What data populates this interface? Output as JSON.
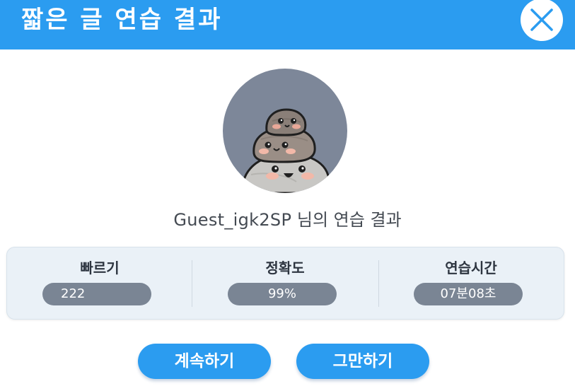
{
  "dialog": {
    "title": "짧은 글 연습 결과",
    "close_icon": "close-icon"
  },
  "user": {
    "name": "Guest_igk2SP",
    "suffix": "님의 연습 결과"
  },
  "stats": [
    {
      "label": "빠르기",
      "value": "222"
    },
    {
      "label": "정확도",
      "value": "99%"
    },
    {
      "label": "연습시간",
      "value": "07분08초"
    }
  ],
  "actions": {
    "continue_label": "계속하기",
    "stop_label": "그만하기"
  },
  "colors": {
    "accent": "#2b9cf0",
    "badge": "#7a8594",
    "avatar_bg": "#7d8799",
    "card_bg": "#eaf1f7"
  }
}
